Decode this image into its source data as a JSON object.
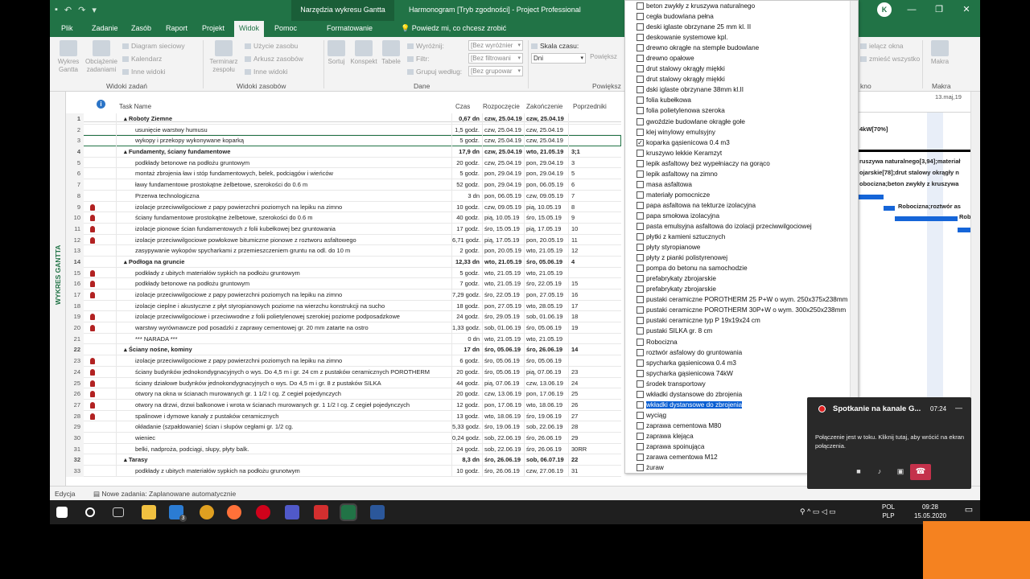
{
  "titlebar": {
    "context_tab": "Narzędzia wykresu Gantta",
    "document": "Harmonogram [Tryb zgodności]  -  Project Professional",
    "user_fragment": "u.pl",
    "avatar": "K"
  },
  "tabs": [
    "Plik",
    "Zadanie",
    "Zasób",
    "Raport",
    "Projekt",
    "Widok",
    "Pomoc",
    "Formatowanie"
  ],
  "tell_me": "Powiedz mi, co chcesz zrobić",
  "ribbon": {
    "task_views": {
      "label": "Widoki zadań",
      "gantt": "Wykres Gantta",
      "usage": "Obciążenie zadaniami",
      "network": "Diagram sieciowy",
      "calendar": "Kalendarz",
      "other": "Inne widoki"
    },
    "resource_views": {
      "label": "Widoki zasobów",
      "planner": "Terminarz zespołu",
      "usage": "Użycie zasobu",
      "sheet": "Arkusz zasobów",
      "other": "Inne widoki"
    },
    "data": {
      "label": "Dane",
      "sort": "Sortuj",
      "outline": "Konspekt",
      "tables": "Tabele",
      "highlight": "Wyróżnij:",
      "filter": "Filtr:",
      "group": "Grupuj według:",
      "highlight_val": "[Bez wyróżnier",
      "filter_val": "[Bez filtrowani",
      "group_val": "[Bez grupowar"
    },
    "zoom": {
      "label": "Powiększ",
      "timescale": "Skala czasu:",
      "timescale_val": "Dni",
      "zoom_btn": "Powiększ"
    },
    "window": {
      "label": "kno",
      "hide": "ielącz okna",
      "arrange": "zmieść wszystko"
    },
    "macros": {
      "label": "Makra",
      "btn": "Makra"
    }
  },
  "view_bar_label": "WYKRES GANTTA",
  "columns": {
    "name": "Task Name",
    "dur": "Czas",
    "start": "Rozpoczęcie",
    "end": "Zakończenie",
    "pred": "Poprzedniki"
  },
  "tasks": [
    {
      "id": "1",
      "name": "▴ Roboty Ziemne",
      "dur": "0,67 dn",
      "start": "czw, 25.04.19",
      "end": "czw, 25.04.19",
      "pred": "",
      "summ": true,
      "res": false,
      "lvl": 0
    },
    {
      "id": "2",
      "name": "usunięcie warstwy humusu",
      "dur": "1,5 godz.",
      "start": "czw, 25.04.19",
      "end": "czw, 25.04.19",
      "pred": "",
      "summ": false,
      "res": false,
      "lvl": 1
    },
    {
      "id": "3",
      "name": "wykopy i przekopy wykonywane koparką",
      "dur": "5 godz.",
      "start": "czw, 25.04.19",
      "end": "czw, 25.04.19",
      "pred": "",
      "summ": false,
      "res": false,
      "lvl": 1,
      "sel": true
    },
    {
      "id": "4",
      "name": "▴ Fundamenty, ściany fundamentowe",
      "dur": "17,9 dn",
      "start": "czw, 25.04.19",
      "end": "wto, 21.05.19",
      "pred": "3;1",
      "summ": true,
      "res": false,
      "lvl": 0
    },
    {
      "id": "5",
      "name": "podkłady betonowe na podłożu gruntowym",
      "dur": "20 godz.",
      "start": "czw, 25.04.19",
      "end": "pon, 29.04.19",
      "pred": "3",
      "summ": false,
      "res": false,
      "lvl": 1
    },
    {
      "id": "6",
      "name": "montaż zbrojenia ław i stóp fundamentowych, belek, podciągów i wieńców",
      "dur": "5 godz.",
      "start": "pon, 29.04.19",
      "end": "pon, 29.04.19",
      "pred": "5",
      "summ": false,
      "res": false,
      "lvl": 1
    },
    {
      "id": "7",
      "name": "ławy fundamentowe prostokątne żelbetowe, szerokości do 0.6 m",
      "dur": "52 godz.",
      "start": "pon, 29.04.19",
      "end": "pon, 06.05.19",
      "pred": "6",
      "summ": false,
      "res": false,
      "lvl": 1
    },
    {
      "id": "8",
      "name": "Przerwa technologiczna",
      "dur": "3 dn",
      "start": "pon, 06.05.19",
      "end": "czw, 09.05.19",
      "pred": "7",
      "summ": false,
      "res": false,
      "lvl": 1
    },
    {
      "id": "9",
      "name": "izolacje przeciwwilgociowe z papy powierzchni poziomych na lepiku na zimno",
      "dur": "10 godz.",
      "start": "czw, 09.05.19",
      "end": "pią, 10.05.19",
      "pred": "8",
      "summ": false,
      "res": true,
      "lvl": 1
    },
    {
      "id": "10",
      "name": "ściany fundamentowe prostokątne żelbetowe, szerokości do 0.6 m",
      "dur": "40 godz.",
      "start": "pią, 10.05.19",
      "end": "śro, 15.05.19",
      "pred": "9",
      "summ": false,
      "res": true,
      "lvl": 1
    },
    {
      "id": "11",
      "name": "izolacje pionowe ścian fundamentowych z folii kubełkowej bez gruntowania",
      "dur": "17 godz.",
      "start": "śro, 15.05.19",
      "end": "pią, 17.05.19",
      "pred": "10",
      "summ": false,
      "res": true,
      "lvl": 1
    },
    {
      "id": "12",
      "name": "izolacje przeciwwilgociowe powłokowe bitumiczne pionowe z roztworu asfaltowego",
      "dur": "6,71 godz.",
      "start": "pią, 17.05.19",
      "end": "pon, 20.05.19",
      "pred": "11",
      "summ": false,
      "res": true,
      "lvl": 1
    },
    {
      "id": "13",
      "name": "zasypywanie wykopów spycharkami z przemieszczeniem gruntu na odl. do 10 m",
      "dur": "2 godz.",
      "start": "pon, 20.05.19",
      "end": "wto, 21.05.19",
      "pred": "12",
      "summ": false,
      "res": false,
      "lvl": 1
    },
    {
      "id": "14",
      "name": "▴ Podłoga na gruncie",
      "dur": "12,33 dn",
      "start": "wto, 21.05.19",
      "end": "śro, 05.06.19",
      "pred": "4",
      "summ": true,
      "res": false,
      "lvl": 0
    },
    {
      "id": "15",
      "name": "podkłady z ubitych materiałów sypkich na podłożu gruntowym",
      "dur": "5 godz.",
      "start": "wto, 21.05.19",
      "end": "wto, 21.05.19",
      "pred": "",
      "summ": false,
      "res": true,
      "lvl": 1
    },
    {
      "id": "16",
      "name": "podkłady betonowe na podłożu gruntowym",
      "dur": "7 godz.",
      "start": "wto, 21.05.19",
      "end": "śro, 22.05.19",
      "pred": "15",
      "summ": false,
      "res": true,
      "lvl": 1
    },
    {
      "id": "17",
      "name": "izolacje przeciwwilgociowe z papy powierzchni poziomych na lepiku na zimno",
      "dur": "7,29 godz.",
      "start": "śro, 22.05.19",
      "end": "pon, 27.05.19",
      "pred": "16",
      "summ": false,
      "res": true,
      "lvl": 1
    },
    {
      "id": "18",
      "name": "izolacje cieplne i akustyczne z płyt styropianowych poziome na wierzchu konstrukcji na sucho",
      "dur": "18 godz.",
      "start": "pon, 27.05.19",
      "end": "wto, 28.05.19",
      "pred": "17",
      "summ": false,
      "res": false,
      "lvl": 1
    },
    {
      "id": "19",
      "name": "izolacje przeciwwilgociowe i przeciwwodne z folii polietylenowej szerokiej poziome podposadzkowe",
      "dur": "24 godz.",
      "start": "śro, 29.05.19",
      "end": "sob, 01.06.19",
      "pred": "18",
      "summ": false,
      "res": true,
      "lvl": 1
    },
    {
      "id": "20",
      "name": "warstwy wyrównawcze pod posadzki z zaprawy cementowej gr. 20 mm zatarte na ostro",
      "dur": "1,33 godz.",
      "start": "sob, 01.06.19",
      "end": "śro, 05.06.19",
      "pred": "19",
      "summ": false,
      "res": true,
      "lvl": 1
    },
    {
      "id": "21",
      "name": "*** NARADA ***",
      "dur": "0 dn",
      "start": "wto, 21.05.19",
      "end": "wto, 21.05.19",
      "pred": "",
      "summ": false,
      "res": false,
      "lvl": 1
    },
    {
      "id": "22",
      "name": "▴ Ściany nośne, kominy",
      "dur": "17 dn",
      "start": "śro, 05.06.19",
      "end": "śro, 26.06.19",
      "pred": "14",
      "summ": true,
      "res": false,
      "lvl": 0
    },
    {
      "id": "23",
      "name": "izolacje przeciwwilgociowe z papy powierzchni poziomych na lepiku na zimno",
      "dur": "6 godz.",
      "start": "śro, 05.06.19",
      "end": "śro, 05.06.19",
      "pred": "",
      "summ": false,
      "res": true,
      "lvl": 1
    },
    {
      "id": "24",
      "name": "ściany budynków jednokondygnacyjnych o wys. Do 4,5 m i gr. 24 cm z pustaków ceramicznych POROTHERM",
      "dur": "20 godz.",
      "start": "śro, 05.06.19",
      "end": "pią, 07.06.19",
      "pred": "23",
      "summ": false,
      "res": true,
      "lvl": 1
    },
    {
      "id": "25",
      "name": "ściany działowe budynków jednokondygnacyjnych o wys. Do 4,5 m i gr. 8 z pustaków SILKA",
      "dur": "44 godz.",
      "start": "pią, 07.06.19",
      "end": "czw, 13.06.19",
      "pred": "24",
      "summ": false,
      "res": true,
      "lvl": 1
    },
    {
      "id": "26",
      "name": "otwory na okna w ścianach murowanych gr. 1 1/2 I cg. Z cegieł pojedynczych",
      "dur": "20 godz.",
      "start": "czw, 13.06.19",
      "end": "pon, 17.06.19",
      "pred": "25",
      "summ": false,
      "res": true,
      "lvl": 1
    },
    {
      "id": "27",
      "name": "otwory na drzwi, drzwi balkonowe i wrota w ścianach murowanych gr. 1 1/2 I cg. Z cegieł pojedynczych",
      "dur": "12 godz.",
      "start": "pon, 17.06.19",
      "end": "wto, 18.06.19",
      "pred": "26",
      "summ": false,
      "res": true,
      "lvl": 1
    },
    {
      "id": "28",
      "name": "spalinowe i dymowe kanały z pustaków ceramicznych",
      "dur": "13 godz.",
      "start": "wto, 18.06.19",
      "end": "śro, 19.06.19",
      "pred": "27",
      "summ": false,
      "res": true,
      "lvl": 1
    },
    {
      "id": "29",
      "name": "okładanie (szpałdowanie) ścian i słupów cegłami gr. 1/2 cg.",
      "dur": "5,33 godz.",
      "start": "śro, 19.06.19",
      "end": "sob, 22.06.19",
      "pred": "28",
      "summ": false,
      "res": false,
      "lvl": 1
    },
    {
      "id": "30",
      "name": "wieniec",
      "dur": "0,24 godz.",
      "start": "sob, 22.06.19",
      "end": "śro, 26.06.19",
      "pred": "29",
      "summ": false,
      "res": false,
      "lvl": 1
    },
    {
      "id": "31",
      "name": "belki, nadproża, podciągi, słupy, płyty balk.",
      "dur": "24 godz.",
      "start": "sob, 22.06.19",
      "end": "śro, 26.06.19",
      "pred": "30RR",
      "summ": false,
      "res": false,
      "lvl": 1
    },
    {
      "id": "32",
      "name": "▴ Tarasy",
      "dur": "8,3 dn",
      "start": "śro, 26.06.19",
      "end": "sob, 06.07.19",
      "pred": "22",
      "summ": true,
      "res": false,
      "lvl": 0
    },
    {
      "id": "33",
      "name": "podkłady z ubitych materiałów sypkich na podłożu grunotwym",
      "dur": "10 godz.",
      "start": "śro, 26.06.19",
      "end": "czw, 27.06.19",
      "pred": "31",
      "summ": false,
      "res": false,
      "lvl": 1
    }
  ],
  "gantt": {
    "date_head": "13.maj,19",
    "labels": [
      "4kW[70%]",
      "ruszywa naturalnego[3,94];materiał",
      "ojarskie[78];drut stalowy okrągły n",
      "obocizna;beton zwykły z kruszywa",
      "Robocizna;roztwór as",
      "Rob"
    ]
  },
  "dropdown": {
    "items": [
      {
        "t": "beton zwykły z kruszywa naturalnego",
        "c": false
      },
      {
        "t": "cegła budowlana pełna",
        "c": false
      },
      {
        "t": "deski iglaste obrzynane 25 mm kl. II",
        "c": false
      },
      {
        "t": "deskowanie systemowe kpl.",
        "c": false
      },
      {
        "t": "drewno okrągłe na stemple budowlane",
        "c": false
      },
      {
        "t": "drewno opałowe",
        "c": false
      },
      {
        "t": "drut stalowy okrągły miękki",
        "c": false
      },
      {
        "t": "drut stalowy okrągły miękki",
        "c": false
      },
      {
        "t": "dski iglaste obrzynane 38mm kl.II",
        "c": false
      },
      {
        "t": "folia kubełkowa",
        "c": false
      },
      {
        "t": "folia polietylenowa szeroka",
        "c": false
      },
      {
        "t": "gwoździe budowlane okrągłe gołe",
        "c": false
      },
      {
        "t": "klej winylowy emulsyjny",
        "c": false
      },
      {
        "t": "koparka gąsienicowa 0.4 m3",
        "c": true
      },
      {
        "t": "kruszywo lekkie Keramzyt",
        "c": false
      },
      {
        "t": "lepik asfaltowy bez wypełniaczy na gorąco",
        "c": false
      },
      {
        "t": "lepik asfaltowy na zimno",
        "c": false
      },
      {
        "t": "masa asfaltowa",
        "c": false
      },
      {
        "t": "materiały pomocnicze",
        "c": false
      },
      {
        "t": "papa asfaltowa na tekturze izolacyjna",
        "c": false
      },
      {
        "t": "papa smołowa izolacyjna",
        "c": false
      },
      {
        "t": "pasta emulsyjna asfaltowa do izolacji przeciwwilgociowej",
        "c": false
      },
      {
        "t": "płytki z kamieni sztucznych",
        "c": false
      },
      {
        "t": "płyty styropianowe",
        "c": false
      },
      {
        "t": "płyty z pianki polistyrenowej",
        "c": false
      },
      {
        "t": "pompa do betonu na samochodzie",
        "c": false
      },
      {
        "t": "prefabrykaty zbrojarskie",
        "c": false
      },
      {
        "t": "prefabrykaty zbrojarskie",
        "c": false
      },
      {
        "t": "pustaki ceramiczne POROTHERM 25 P+W o wym. 250x375x238mm",
        "c": false
      },
      {
        "t": "pustaki ceramiczne POROTHERM 30P+W o wym. 300x250x238mm",
        "c": false
      },
      {
        "t": "pustaki ceramiczne typ P 19x19x24 cm",
        "c": false
      },
      {
        "t": "pustaki SILKA gr. 8 cm",
        "c": false
      },
      {
        "t": "Robocizna",
        "c": false
      },
      {
        "t": "roztwór asfalowy do gruntowania",
        "c": false
      },
      {
        "t": "spycharka gąsienicowa 0.4 m3",
        "c": false
      },
      {
        "t": "spycharka gąsienicowa 74kW",
        "c": false
      },
      {
        "t": "środek transportowy",
        "c": false
      },
      {
        "t": "wkładki dystansowe do zbrojenia",
        "c": false
      },
      {
        "t": "wkładki dystansowe do zbrojenia",
        "c": false,
        "hl": true
      },
      {
        "t": "wyciąg",
        "c": false
      },
      {
        "t": "zaprawa cementowa M80",
        "c": false
      },
      {
        "t": "zaprawa klejąca",
        "c": false
      },
      {
        "t": "zaprawa spoinująca",
        "c": false
      },
      {
        "t": "zarawa cementowa M12",
        "c": false
      },
      {
        "t": "żuraw",
        "c": false
      }
    ]
  },
  "status": {
    "mode": "Edycja",
    "new_tasks": "Nowe zadania: Zaplanowane automatycznie"
  },
  "teams": {
    "title": "Spotkanie na kanale G...",
    "time": "07:24",
    "message": "Połączenie jest w toku. Kliknij tutaj, aby wrócić na ekran połączenia."
  },
  "tray": {
    "lang1": "POL",
    "lang2": "PLP",
    "time": "09:28",
    "date": "15.05.2020",
    "mail_badge": "3"
  }
}
